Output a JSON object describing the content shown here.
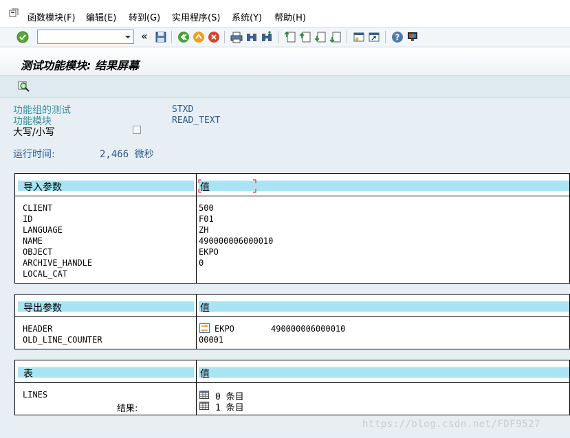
{
  "menu": {
    "items": [
      "函数模块(F)",
      "编辑(E)",
      "转到(G)",
      "实用程序(S)",
      "系统(Y)",
      "帮助(H)"
    ]
  },
  "toolbar": {
    "command_value": "",
    "history_symbol": "«"
  },
  "title": "测试功能模块: 结果屏幕",
  "info": {
    "group_label": "功能组的测试",
    "group_value": "STXD",
    "module_label": "功能模块",
    "module_value": "READ_TEXT",
    "case_label": "大写/小写",
    "runtime_label": "运行时间:",
    "runtime_value": "2,466 微秒"
  },
  "import_params": {
    "header_left": "导入参数",
    "header_right": "值",
    "names": [
      "CLIENT",
      "ID",
      "LANGUAGE",
      "NAME",
      "OBJECT",
      "ARCHIVE_HANDLE",
      "LOCAL_CAT"
    ],
    "values": [
      "500",
      "F01",
      "ZH",
      "490000006000010",
      "EKPO",
      "0",
      ""
    ]
  },
  "export_params": {
    "header_left": "导出参数",
    "header_right": "值",
    "names": [
      "HEADER",
      "OLD_LINE_COUNTER"
    ],
    "header_value_obj": "EKPO",
    "header_value_name": "490000006000010",
    "old_line_counter": "00001"
  },
  "tables": {
    "header_left": "表",
    "header_right": "值",
    "row_name": "LINES",
    "result_label": "结果:",
    "entries_1": "0 条目",
    "entries_2": "1 条目"
  },
  "watermark": "https://blog.csdn.net/FDF9527"
}
